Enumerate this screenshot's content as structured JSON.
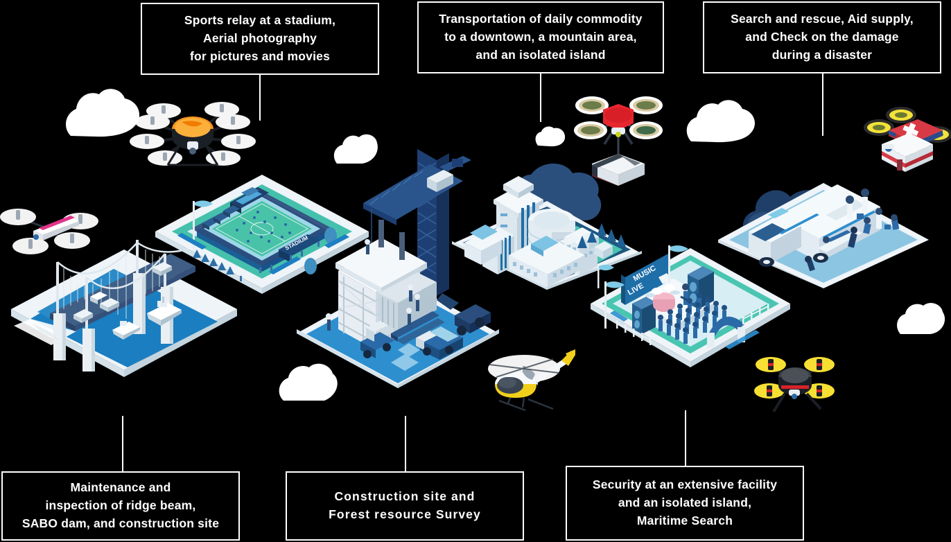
{
  "meta": {
    "background_color": "#000000",
    "box_border_color": "#ffffff",
    "text_color": "#ffffff",
    "accent_blue": "#1b6ca8",
    "deep_navy": "#1f3864",
    "light_blue": "#bcdcf0",
    "teal": "#49c5b1",
    "cloud_color": "#ffffff"
  },
  "callouts": [
    {
      "id": "sports-relay",
      "lines": [
        "Sports relay at a stadium,",
        "Aerial photography",
        "for pictures and movies"
      ]
    },
    {
      "id": "transportation",
      "lines": [
        "Transportation of daily commodity",
        "to a downtown, a mountain area,",
        "and an isolated island"
      ]
    },
    {
      "id": "search-rescue",
      "lines": [
        "Search and rescue, Aid supply,",
        "and Check on the damage",
        "during a disaster"
      ]
    },
    {
      "id": "maintenance",
      "lines": [
        "Maintenance and",
        "inspection of ridge beam,",
        "SABO dam, and construction site"
      ]
    },
    {
      "id": "construction-forest",
      "lines": [
        "Construction site and",
        "Forest resource Survey"
      ]
    },
    {
      "id": "security-maritime",
      "lines": [
        "Security at an extensive facility",
        "and an isolated island,",
        "Maritime Search"
      ]
    }
  ],
  "scenes": {
    "bridge": {
      "name": "suspension-bridge-scene",
      "signs": []
    },
    "stadium": {
      "name": "stadium-scene",
      "signs": [
        "STADIUM"
      ]
    },
    "construction": {
      "name": "construction-site-scene",
      "signs": []
    },
    "city": {
      "name": "city-downtown-scene",
      "signs": []
    },
    "concert": {
      "name": "music-live-venue-scene",
      "signs": [
        "MUSIC",
        "LIVE"
      ]
    },
    "disaster": {
      "name": "disaster-rescue-scene",
      "signs": []
    }
  },
  "aircraft": [
    {
      "id": "pink-quadcopter",
      "body_color": "#e2338a",
      "rotor_color": "#ffffff"
    },
    {
      "id": "orange-octocopter",
      "body_color": "#f5911e",
      "rotor_color": "#ffffff"
    },
    {
      "id": "red-delivery-drone",
      "body_color": "#e8262f",
      "rotor_color": "#d8c9a0"
    },
    {
      "id": "medical-rescue-drone",
      "body_color": "#d83a45",
      "rotor_color": "#f2e23a"
    },
    {
      "id": "yellow-helicopter",
      "body_color": "#f2cf1c",
      "rotor_color": "#ffffff"
    },
    {
      "id": "black-yellow-drone",
      "body_color": "#2b2b2b",
      "rotor_color": "#f7e033"
    }
  ]
}
